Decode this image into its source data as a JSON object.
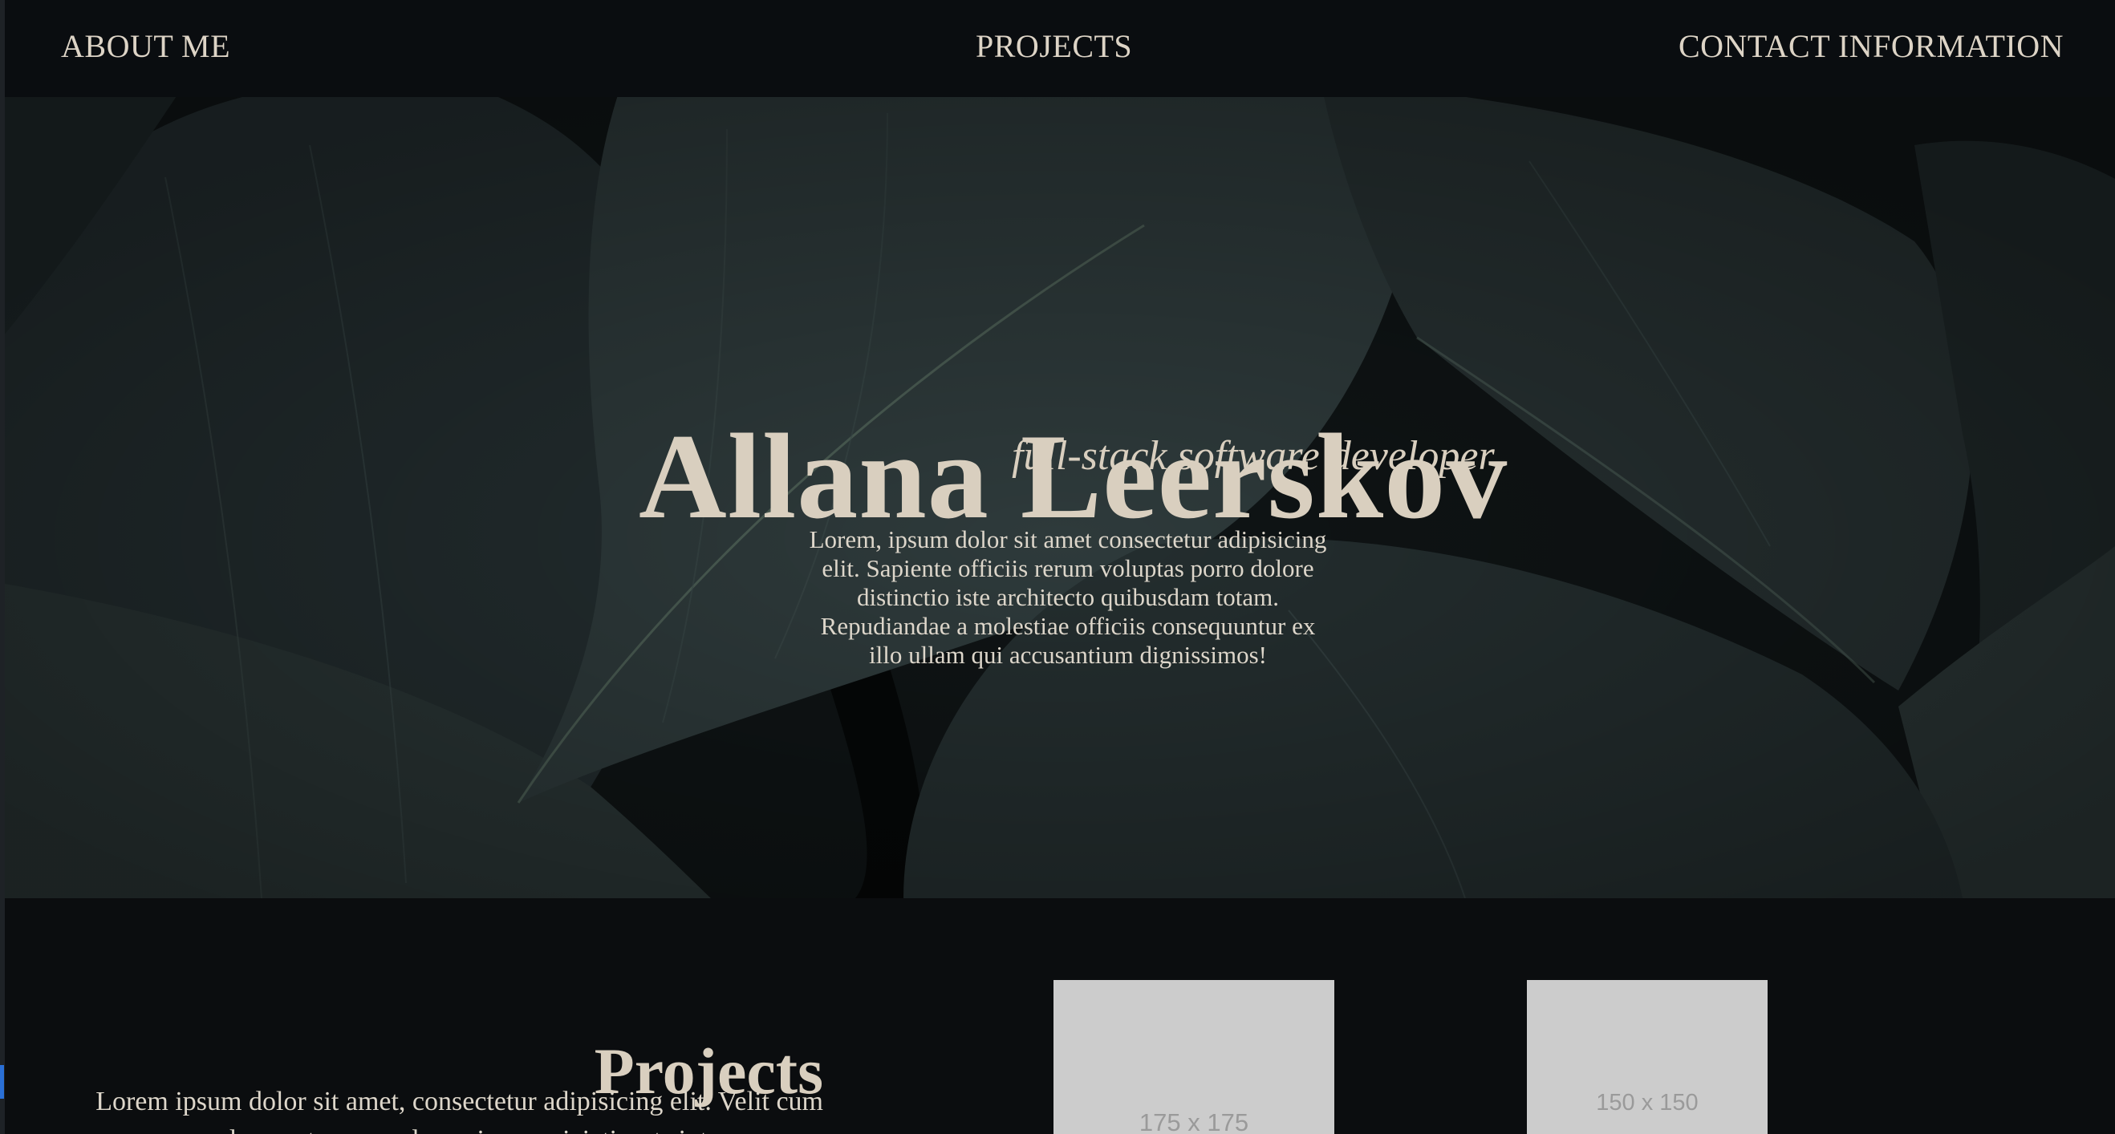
{
  "nav": {
    "about": "ABOUT ME",
    "projects": "PROJECTS",
    "contact": "CONTACT INFORMATION"
  },
  "hero": {
    "name": "Allana Leerskov",
    "tagline": "full-stack software developer",
    "description": "Lorem, ipsum dolor sit amet consectetur adipisicing elit. Sapiente officiis rerum voluptas porro dolore distinctio iste architecto quibusdam totam. Repudiandae a molestiae officiis consequuntur ex illo ullam qui accusantium dignissimos!"
  },
  "projects": {
    "heading": "Projects",
    "text": "Lorem ipsum dolor sit amet, consectetur adipisicing elit. Velit cum deserunt recusandae quia perspiciatis, at sint numquam",
    "thumbnails": [
      {
        "label": "175 x 175"
      },
      {
        "label": "150 x 150"
      }
    ]
  },
  "colors": {
    "background": "#0b0d0f",
    "text": "#d9cfbf",
    "leaf_dark": "#1c2426",
    "leaf_mid": "#2b3636",
    "placeholder": "#cccccc"
  }
}
